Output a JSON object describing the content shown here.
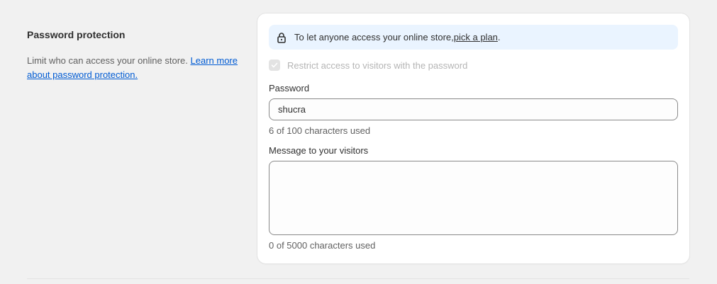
{
  "section": {
    "title": "Password protection",
    "description_prefix": "Limit who can access your online store. ",
    "description_link": "Learn more about password protection."
  },
  "banner": {
    "icon": "lock-icon",
    "text": "To let anyone access your online store, ",
    "link": "pick a plan",
    "suffix": ".",
    "background": "#eaf4ff"
  },
  "restrict_checkbox": {
    "label": "Restrict access to visitors with the password",
    "checked": true,
    "disabled": true
  },
  "password": {
    "label": "Password",
    "value": "shucra",
    "help": "6 of 100 characters used"
  },
  "message": {
    "label": "Message to your visitors",
    "value": "",
    "help": "0 of 5000 characters used"
  }
}
